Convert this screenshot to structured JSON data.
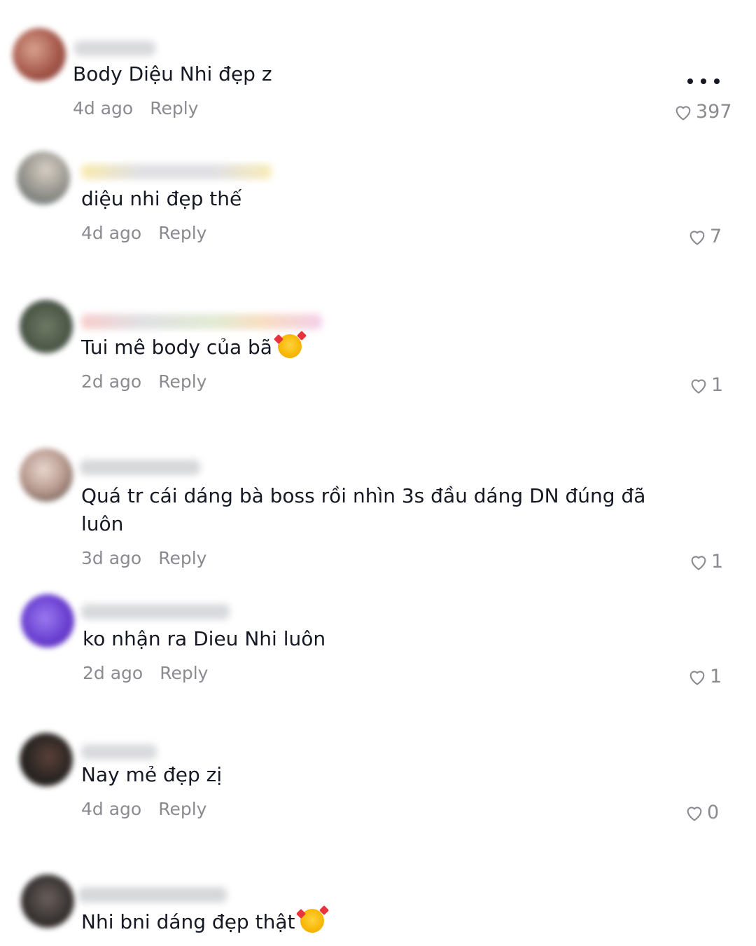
{
  "comments": [
    {
      "username": "",
      "text": "Body Diệu Nhi đẹp z",
      "time": "4d ago",
      "reply": "Reply",
      "likes": "397",
      "avatar_color": "#b5746a",
      "has_emoji": false
    },
    {
      "username": "",
      "text": "diệu nhi đẹp thế",
      "time": "4d ago",
      "reply": "Reply",
      "likes": "7",
      "avatar_color": "#8d8c86",
      "has_emoji": false
    },
    {
      "username": "",
      "text": "Tui mê body của bã",
      "time": "2d ago",
      "reply": "Reply",
      "likes": "1",
      "avatar_color": "#4f5a48",
      "has_emoji": true
    },
    {
      "username": "",
      "text": "Quá tr cái dáng bà boss rồi nhìn 3s đầu dáng DN đúng đã",
      "text2": "luôn",
      "time": "3d ago",
      "reply": "Reply",
      "likes": "1",
      "avatar_color": "#a08075",
      "has_emoji": false
    },
    {
      "username": "",
      "text": "ko nhận ra Dieu Nhi luôn",
      "time": "2d ago",
      "reply": "Reply",
      "likes": "1",
      "avatar_color": "#6a3fd1",
      "has_emoji": false
    },
    {
      "username": "",
      "text": "Nay mẻ đẹp zị",
      "time": "4d ago",
      "reply": "Reply",
      "likes": "0",
      "avatar_color": "#2a2522",
      "has_emoji": false
    },
    {
      "username": "",
      "text": "Nhi bni dáng đẹp thật",
      "avatar_color": "#3a3533",
      "has_emoji": true
    }
  ],
  "icons": {
    "heart": "heart-outline-icon",
    "more": "more-horizontal-icon",
    "emoji": "smiling-face-with-hearts-emoji"
  },
  "colors": {
    "text": "#161823",
    "muted": "#8a8b91",
    "background": "#ffffff"
  }
}
